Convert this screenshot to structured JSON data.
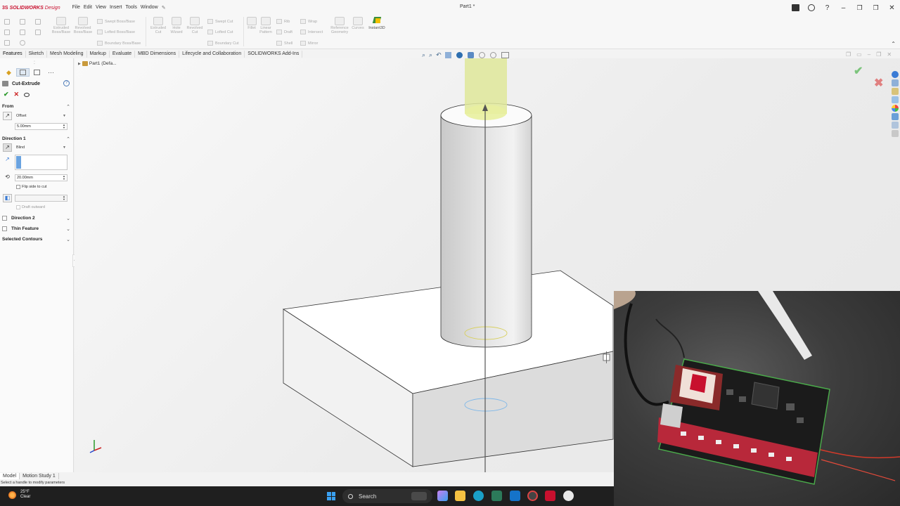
{
  "app": {
    "logo_ds": "3S",
    "logo_name": "SOLIDWORKS",
    "logo_suffix": "Design",
    "title": "Part1 *"
  },
  "menu": [
    "File",
    "Edit",
    "View",
    "Insert",
    "Tools",
    "Window"
  ],
  "ribbon": {
    "buttons": [
      {
        "label": "Extruded Boss/Base"
      },
      {
        "label": "Revolved Boss/Base"
      },
      {
        "label": "Extruded Cut"
      },
      {
        "label": "Hole Wizard"
      },
      {
        "label": "Revolved Cut"
      },
      {
        "label": "Fillet"
      },
      {
        "label": "Linear Pattern"
      },
      {
        "label": "Reference Geometry"
      },
      {
        "label": "Curves"
      }
    ],
    "small_buttons": [
      {
        "label": "Swept Boss/Base"
      },
      {
        "label": "Lofted Boss/Base"
      },
      {
        "label": "Boundary Boss/Base"
      },
      {
        "label": "Swept Cut"
      },
      {
        "label": "Lofted Cut"
      },
      {
        "label": "Boundary Cut"
      },
      {
        "label": "Rib"
      },
      {
        "label": "Draft"
      },
      {
        "label": "Shell"
      },
      {
        "label": "Wrap"
      },
      {
        "label": "Intersect"
      },
      {
        "label": "Mirror"
      }
    ],
    "instant3d": "Instant3D"
  },
  "cm_tabs": [
    "Features",
    "Sketch",
    "Mesh Modeling",
    "Markup",
    "Evaluate",
    "MBD Dimensions",
    "Lifecycle and Collaboration",
    "SOLIDWORKS Add-Ins"
  ],
  "property_manager": {
    "title": "Cut-Extrude",
    "help": "?",
    "from": {
      "header": "From",
      "type": "Offset",
      "offset_value": "5.00mm"
    },
    "direction1": {
      "header": "Direction 1",
      "end_condition": "Blind",
      "depth": "20.00mm",
      "flip_side": "Flip side to cut",
      "draft_outward": "Draft outward"
    },
    "collapsed_sections": [
      {
        "label": "Direction 2"
      },
      {
        "label": "Thin Feature"
      },
      {
        "label": "Selected Contours"
      }
    ]
  },
  "tree": {
    "root": "Part1 (Defa..."
  },
  "bottom_tabs": [
    "Model",
    "Motion Study 1"
  ],
  "status_text": "Select a handle to modify parameters",
  "taskbar": {
    "temp": "25°F",
    "condition": "Clear",
    "search": "Search"
  },
  "colors": {
    "accent_blue": "#3aa0f0",
    "ok_green": "#2c9a2c",
    "cancel_red": "#cc2222",
    "preview_yellow": "#dfe89a",
    "brand_red": "#c8102e"
  }
}
